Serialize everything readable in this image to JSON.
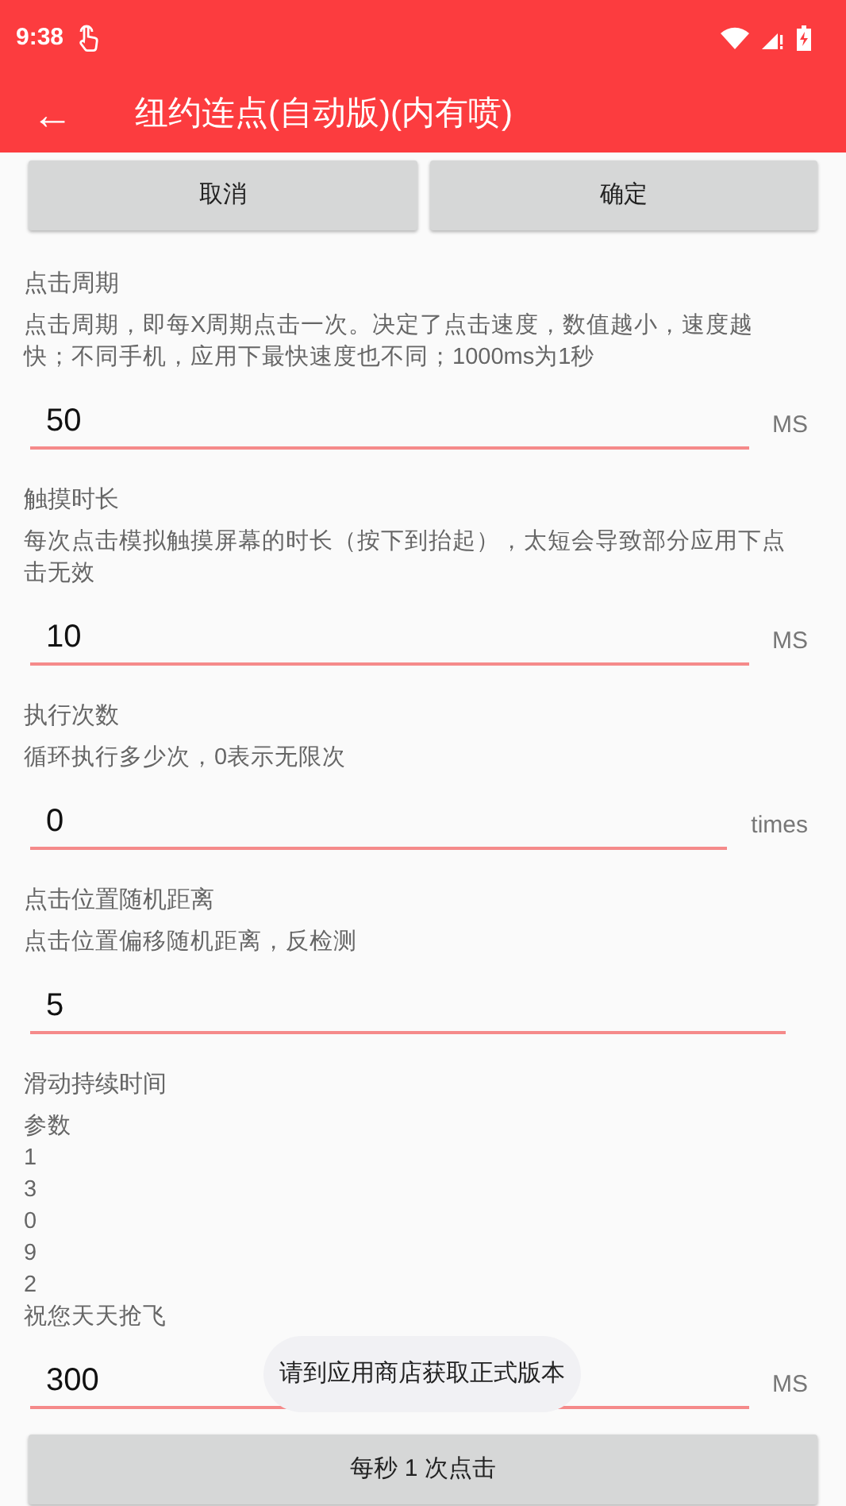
{
  "status_bar": {
    "time": "9:38"
  },
  "app_bar": {
    "back": "←",
    "title": "纽约连点(自动版)(内有喷)"
  },
  "top_buttons": [
    "取消",
    "确定"
  ],
  "settings": [
    {
      "title": "点击周期",
      "description": [
        "点击周期，即每X周期点击一次。决定了点击速度，数值越小，速度越快；不同手机，应用下最快速度也不同；1000ms为1秒"
      ],
      "value": "50",
      "unit": "MS"
    },
    {
      "title": "触摸时长",
      "description": [
        "每次点击模拟触摸屏幕的时长（按下到抬起），太短会导致部分应用下点击无效"
      ],
      "value": "10",
      "unit": "MS"
    },
    {
      "title": "执行次数",
      "description": [
        "循环执行多少次，0表示无限次"
      ],
      "value": "0",
      "unit": "times"
    },
    {
      "title": "点击位置随机距离",
      "description": [
        "点击位置偏移随机距离，反检测"
      ],
      "value": "5"
    },
    {
      "title": "滑动持续时间",
      "description": [
        "参数",
        "1",
        "3",
        "0",
        "9",
        "2",
        "祝您天天抢飞"
      ],
      "value": "300",
      "unit": "MS"
    }
  ],
  "toast": "请到应用商店获取正式版本",
  "bottom_button": "每秒 1 次点击"
}
